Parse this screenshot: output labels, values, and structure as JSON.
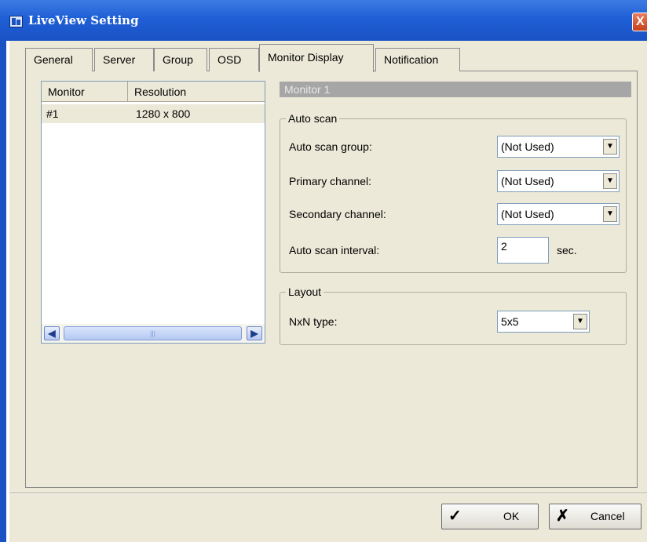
{
  "window": {
    "title": "LiveView Setting",
    "close_glyph": "X"
  },
  "tabs": [
    {
      "label": "General"
    },
    {
      "label": "Server"
    },
    {
      "label": "Group"
    },
    {
      "label": "OSD"
    },
    {
      "label": "Monitor Display",
      "active": true
    },
    {
      "label": "Notification"
    }
  ],
  "monitor_list": {
    "columns": [
      "Monitor",
      "Resolution"
    ],
    "rows": [
      {
        "monitor": "#1",
        "resolution": "1280 x 800"
      }
    ],
    "scroll_thumb": "|||"
  },
  "monitor_panel": {
    "title": "Monitor 1",
    "auto_scan": {
      "title": "Auto scan",
      "group_label": "Auto scan group:",
      "group_value": "(Not Used)",
      "primary_label": "Primary channel:",
      "primary_value": "(Not Used)",
      "secondary_label": "Secondary channel:",
      "secondary_value": "(Not Used)",
      "interval_label": "Auto scan interval:",
      "interval_value": "2",
      "interval_unit": "sec."
    },
    "layout": {
      "title": "Layout",
      "nxn_label": "NxN type:",
      "nxn_value": "5x5"
    }
  },
  "buttons": {
    "ok": "OK",
    "cancel": "Cancel"
  },
  "icons": {
    "title": "window-icon",
    "ok": "checkmark-icon",
    "cancel": "x-icon",
    "dropdown": "triangle-down-icon"
  }
}
